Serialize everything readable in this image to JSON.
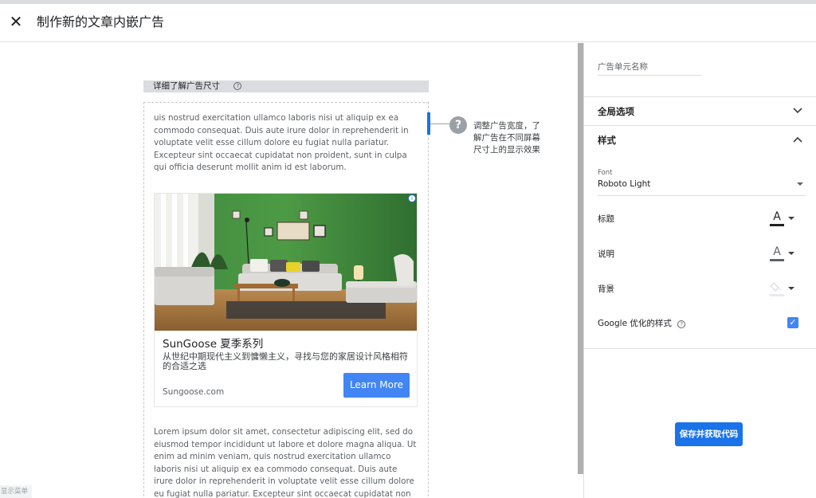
{
  "header": {
    "close_icon": "✕",
    "title": "制作新的文章内嵌广告"
  },
  "preview": {
    "learn_size_label": "详细了解广告尺寸",
    "learn_size_help": "?",
    "hint_icon": "?",
    "hint_text": "调整广告宽度，了解广告在不同屏幕尺寸上的显示效果",
    "paragraph_top": "uis nostrud exercitation ullamco laboris nisi ut aliquip ex ea commodo consequat. Duis aute irure dolor in reprehenderit in voluptate velit esse cillum dolore eu fugiat nulla pariatur. Excepteur sint occaecat cupidatat non proident, sunt in culpa qui officia deserunt mollit anim id est laborum.",
    "paragraph_bottom": "Lorem ipsum dolor sit amet, consectetur adipiscing elit, sed do eiusmod tempor incididunt ut labore et dolore magna aliqua. Ut enim ad minim veniam, quis nostrud exercitation ullamco laboris nisi ut aliquip ex ea commodo consequat. Duis aute irure dolor in reprehenderit in voluptate velit esse cillum dolore eu fugiat nulla pariatur. Excepteur sint occaecat cupidatat non proident, sunt in culpa",
    "ad": {
      "info_icon": "i",
      "headline": "SunGoose 夏季系列",
      "description": "从世纪中期现代主义到慵懒主义，寻找与您的家居设计风格相符的合适之选",
      "domain": "Sungoose.com",
      "cta": "Learn More"
    },
    "menu_label": "显示菜单"
  },
  "settings": {
    "ad_unit_name_placeholder": "广告单元名称",
    "global_options": "全局选项",
    "style_section": "样式",
    "font_label": "Font",
    "font_value": "Roboto Light",
    "title_label": "标题",
    "description_label": "说明",
    "background_label": "背景",
    "google_optimized_label": "Google 优化的样式",
    "google_optimized_help": "?",
    "google_optimized_checked": true,
    "check_mark": "✓",
    "color_glyph": "A",
    "title_color": "#202124",
    "description_color": "#5f6368",
    "background_color": "#e8eaed",
    "save_button": "保存并获取代码"
  },
  "colors": {
    "accent": "#1a73e8",
    "cta_blue": "#4285f4"
  }
}
